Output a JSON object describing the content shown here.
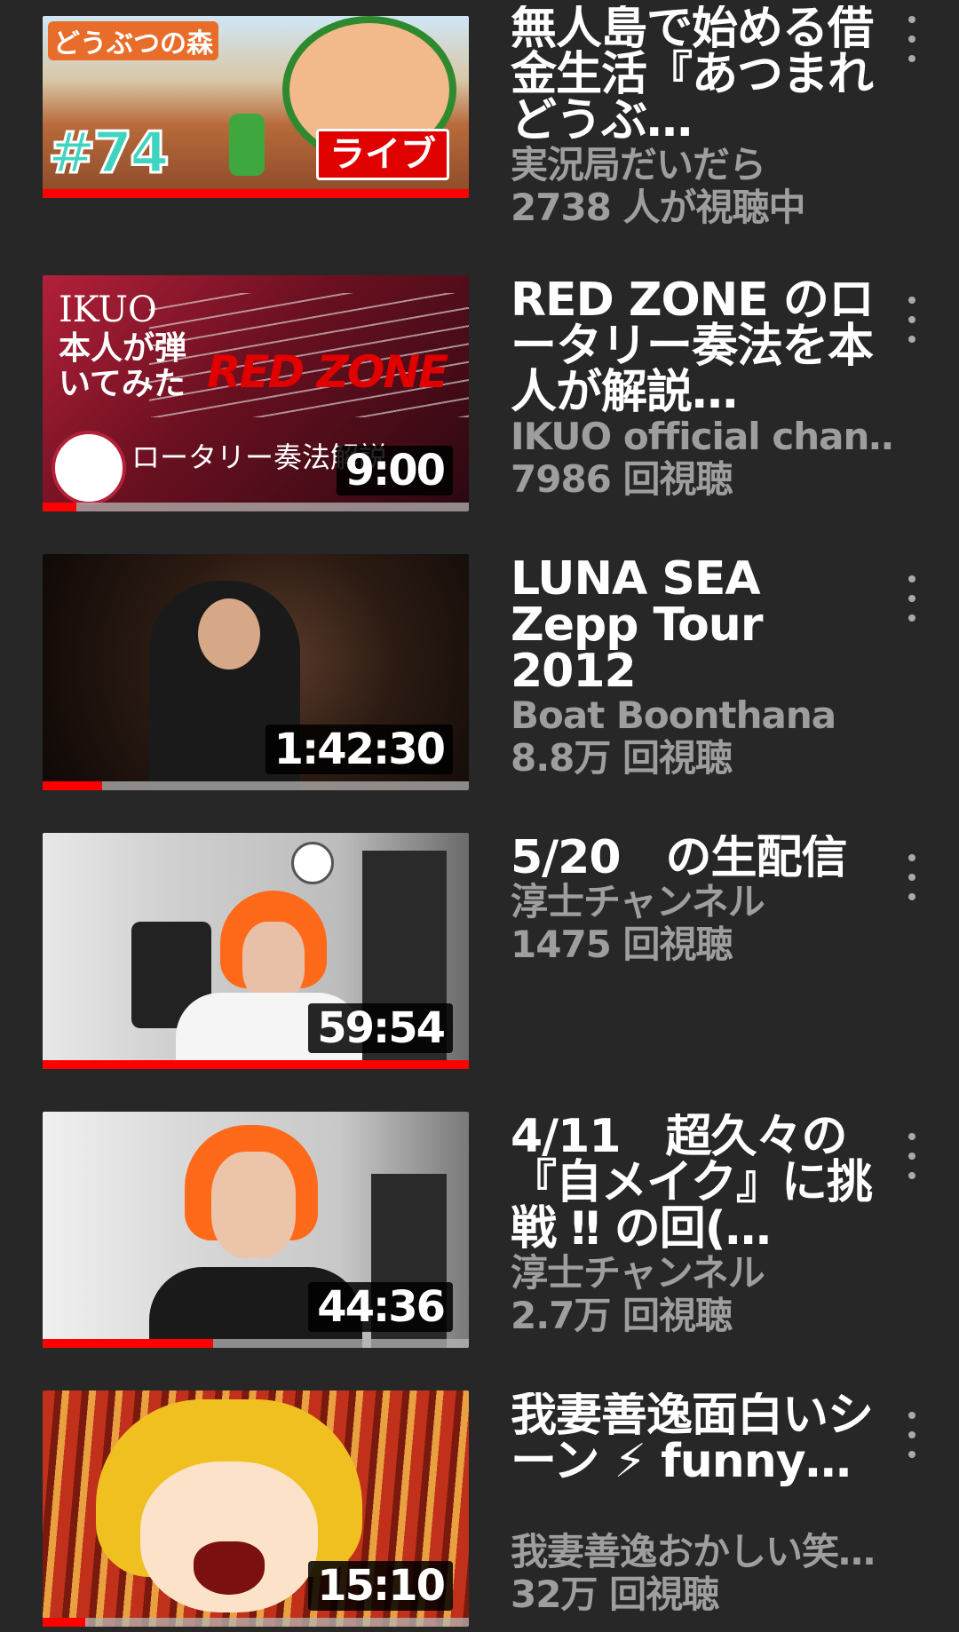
{
  "videos": [
    {
      "title": "無人島で始める借金生活『あつまれ どうぶ…",
      "channel": "実況局だいだら",
      "stats": "2738 人が視聴中",
      "badge": "ライブ",
      "thumb_texts": [
        "どうぶつの森",
        "#74"
      ],
      "progress": 1.0
    },
    {
      "title": "RED ZONE のロータリー奏法を本人が解説…",
      "channel": "IKUO official chan…",
      "stats": "7986 回視聴",
      "duration": "9:00",
      "thumb_texts": [
        "IKUO",
        "本人が弾いてみた",
        "RED ZONE",
        "ロータリー奏法解説"
      ],
      "progress": 0.08
    },
    {
      "title": "LUNA SEA Zepp Tour 2012",
      "channel": "Boat Boonthana",
      "stats": "8.8万 回視聴",
      "duration": "1:42:30",
      "progress": 0.14
    },
    {
      "title": "5/20　の生配信",
      "channel": "淳士チャンネル",
      "stats": "1475 回視聴",
      "duration": "59:54",
      "progress": 1.0
    },
    {
      "title": "4/11　超久々の『自メイク』に挑戦 ‼ の回(…",
      "channel": "淳士チャンネル",
      "stats": "2.7万 回視聴",
      "duration": "44:36",
      "progress": 0.4
    },
    {
      "title": "我妻善逸面白いシーン ⚡ funny…",
      "channel": "我妻善逸おかしい笑…",
      "stats": "32万 回視聴",
      "duration": "15:10",
      "progress": 0.1
    }
  ],
  "colors": {
    "background": "#272727",
    "title": "#ffffff",
    "secondary": "#9e9e9e",
    "progress": "#ff0000"
  },
  "icons": {
    "menu": "more-vert-icon"
  }
}
